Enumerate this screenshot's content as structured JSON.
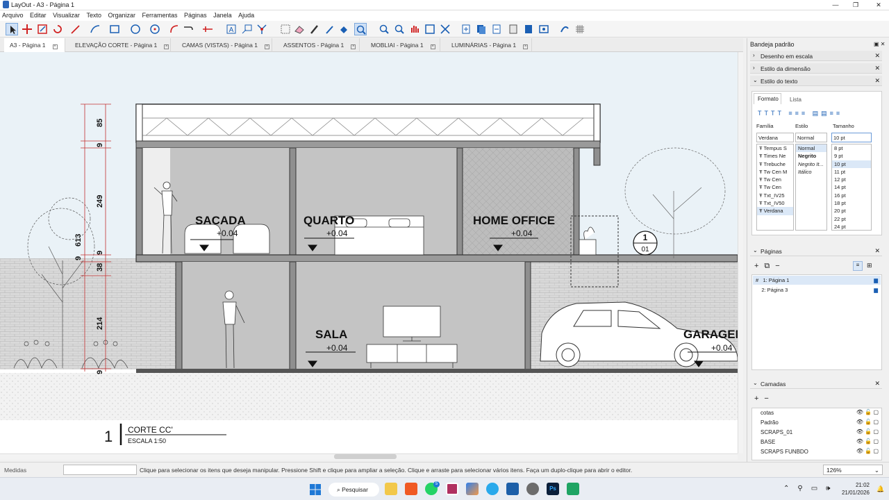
{
  "window": {
    "title": "LayOut - A3 - Página 1",
    "controls": [
      "—",
      "❐",
      "✕"
    ]
  },
  "menu": [
    "Arquivo",
    "Editar",
    "Visualizar",
    "Texto",
    "Organizar",
    "Ferramentas",
    "Janela",
    "Páginas",
    "Ajuda"
  ],
  "tabs": [
    {
      "label": "A3 - Página 1",
      "active": true
    },
    {
      "label": "ELEVAÇÃO CORTE - Página 1",
      "active": false
    },
    {
      "label": "CAMAS (VISTAS) - Página 1",
      "active": false
    },
    {
      "label": "ASSENTOS - Página 1",
      "active": false
    },
    {
      "label": "MOBLIAI - Página 1",
      "active": false
    },
    {
      "label": "LUMINÁRIAS - Página 1",
      "active": false
    }
  ],
  "drawing": {
    "rooms": [
      {
        "name": "SACADA",
        "level": "+0.04"
      },
      {
        "name": "QUARTO",
        "level": "+0.04"
      },
      {
        "name": "HOME OFFICE",
        "level": "+0.04"
      },
      {
        "name": "SALA",
        "level": "+0.04"
      },
      {
        "name": "GARAGEM",
        "level": "+0.04"
      }
    ],
    "dimensions": [
      "85",
      "9",
      "249",
      "613",
      "9",
      "38",
      "214",
      "9",
      "9"
    ],
    "section_marker": {
      "number": "1",
      "sheet": "01"
    },
    "title_number": "1",
    "title": "CORTE CC'",
    "scale": "ESCALA 1:50"
  },
  "panel": {
    "title": "Bandeja padrão",
    "sections": [
      "Desenho em escala",
      "Estilo da dimensão",
      "Estilo do texto"
    ],
    "text_tabs": [
      "Formato",
      "Lista"
    ],
    "labels": {
      "family": "Família",
      "style": "Estilo",
      "size": "Tamanho"
    },
    "family_value": "Verdana",
    "style_value": "Normal",
    "size_value": "10 pt",
    "fonts": [
      "Tempus S",
      "Times Ne",
      "Trebuche",
      "Tw Cen M",
      "Tw Cen",
      "Tw Cen",
      "Txt_IV25",
      "Txt_IV50",
      "Verdana"
    ],
    "styles": [
      "Normal",
      "Negrito",
      "Negrito It...",
      "Itálico"
    ],
    "sizes": [
      "8 pt",
      "9 pt",
      "10 pt",
      "11 pt",
      "12 pt",
      "14 pt",
      "16 pt",
      "18 pt",
      "20 pt",
      "22 pt",
      "24 pt"
    ],
    "pages_title": "Páginas",
    "pages": [
      {
        "label": "1: Página 1",
        "selected": true
      },
      {
        "label": "2: Página 3",
        "selected": false
      }
    ],
    "layers_title": "Camadas",
    "layers": [
      "cotas",
      "Padrão",
      "SCRAPS_01",
      "BASE",
      "SCRAPS FUNBDO"
    ]
  },
  "status": {
    "measures_label": "Medidas",
    "hint": "Clique para selecionar os itens que deseja manipular. Pressione Shift e clique para ampliar a seleção. Clique e arraste para selecionar vários itens. Faça um duplo-clique para abrir o editor.",
    "zoom": "126%"
  },
  "taskbar": {
    "search": "Pesquisar",
    "time": "21:02",
    "date": "21/01/2026",
    "badge": "5"
  },
  "colors": {
    "accent": "#1a73c7",
    "wall": "#a3a3a3",
    "room": "#c2c2c2",
    "sky": "#eaf2f7"
  }
}
